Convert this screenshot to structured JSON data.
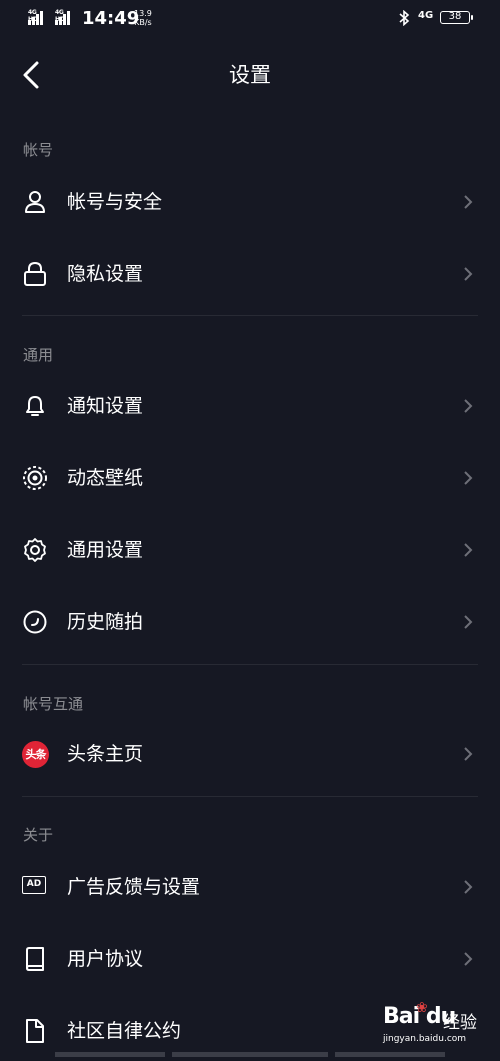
{
  "status_bar": {
    "sim1": "4G HD",
    "sim2": "4G HD",
    "time": "14:49",
    "speed_value": "13.9",
    "speed_unit": "KB/s",
    "network": "4G",
    "battery": "38"
  },
  "header": {
    "title": "设置"
  },
  "sections": {
    "account": {
      "label": "帐号",
      "items": [
        {
          "label": "帐号与安全",
          "icon": "person-icon"
        },
        {
          "label": "隐私设置",
          "icon": "lock-icon"
        }
      ]
    },
    "general": {
      "label": "通用",
      "items": [
        {
          "label": "通知设置",
          "icon": "bell-icon"
        },
        {
          "label": "动态壁纸",
          "icon": "live-wallpaper-icon"
        },
        {
          "label": "通用设置",
          "icon": "gear-icon"
        },
        {
          "label": "历史随拍",
          "icon": "history-icon"
        }
      ]
    },
    "linked": {
      "label": "帐号互通",
      "items": [
        {
          "label": "头条主页",
          "icon": "toutiao-icon",
          "badge": "头条"
        }
      ]
    },
    "about": {
      "label": "关于",
      "items": [
        {
          "label": "广告反馈与设置",
          "icon": "ad-icon",
          "badge": "AD"
        },
        {
          "label": "用户协议",
          "icon": "book-icon"
        },
        {
          "label": "社区自律公约",
          "icon": "document-icon"
        }
      ]
    }
  },
  "watermark": {
    "logo": "Bai du",
    "text": "经验",
    "url": "jingyan.baidu.com"
  },
  "colors": {
    "background": "#161823",
    "text": "#ffffff",
    "muted": "#7f8089",
    "toutiao_red": "#e02436"
  }
}
